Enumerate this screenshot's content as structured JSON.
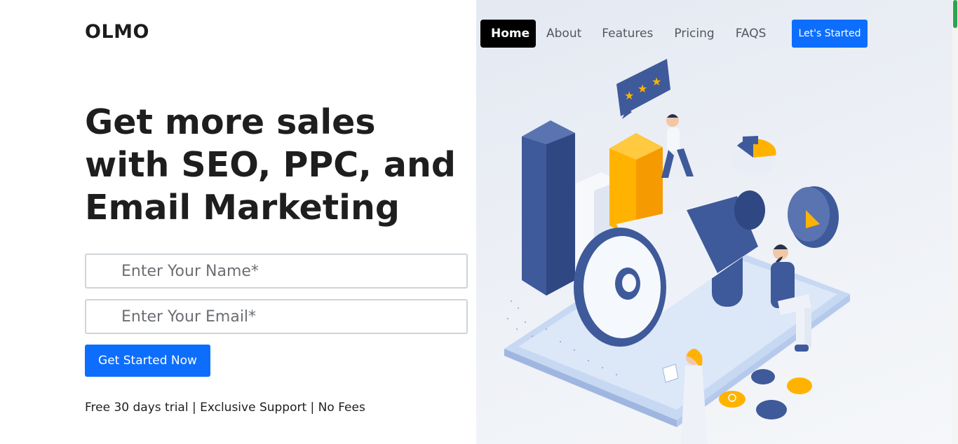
{
  "brand": "OLMO",
  "nav": {
    "items": [
      {
        "label": "Home"
      },
      {
        "label": "About"
      },
      {
        "label": "Features"
      },
      {
        "label": "Pricing"
      },
      {
        "label": "FAQS"
      }
    ],
    "cta_label": "Let's Started"
  },
  "hero": {
    "title": "Get more sales with SEO, PPC, and Email Marketing",
    "name_placeholder": "Enter Your Name*",
    "email_placeholder": "Enter Your Email*",
    "button_label": "Get Started Now",
    "perks": "Free 30 days trial | Exclusive Support | No Fees"
  },
  "colors": {
    "primary": "#0d6efd",
    "active_nav": "#000000",
    "illustration_blue": "#3f5a9a",
    "illustration_orange": "#ffb300"
  },
  "icons": [
    "megaphone-icon",
    "star-rating-icon",
    "pie-chart-icon",
    "play-bubble-icon"
  ]
}
